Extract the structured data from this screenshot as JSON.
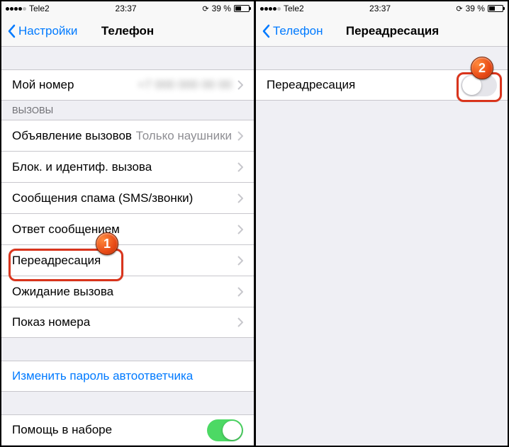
{
  "status": {
    "carrier": "Tele2",
    "time": "23:37",
    "battery_text": "39 %"
  },
  "left": {
    "back_label": "Настройки",
    "title": "Телефон",
    "my_number_label": "Мой номер",
    "section_calls": "ВЫЗОВЫ",
    "announce_label": "Объявление вызовов",
    "announce_value": "Только наушники",
    "block_id_label": "Блок. и идентиф. вызова",
    "spam_label": "Сообщения спама (SMS/звонки)",
    "reply_label": "Ответ сообщением",
    "forwarding_label": "Переадресация",
    "waiting_label": "Ожидание вызова",
    "callerid_label": "Показ номера",
    "change_vm_password": "Изменить пароль автоответчика",
    "dial_assist_label": "Помощь в наборе"
  },
  "right": {
    "back_label": "Телефон",
    "title": "Переадресация",
    "forwarding_label": "Переадресация"
  },
  "callouts": {
    "one": "1",
    "two": "2"
  }
}
